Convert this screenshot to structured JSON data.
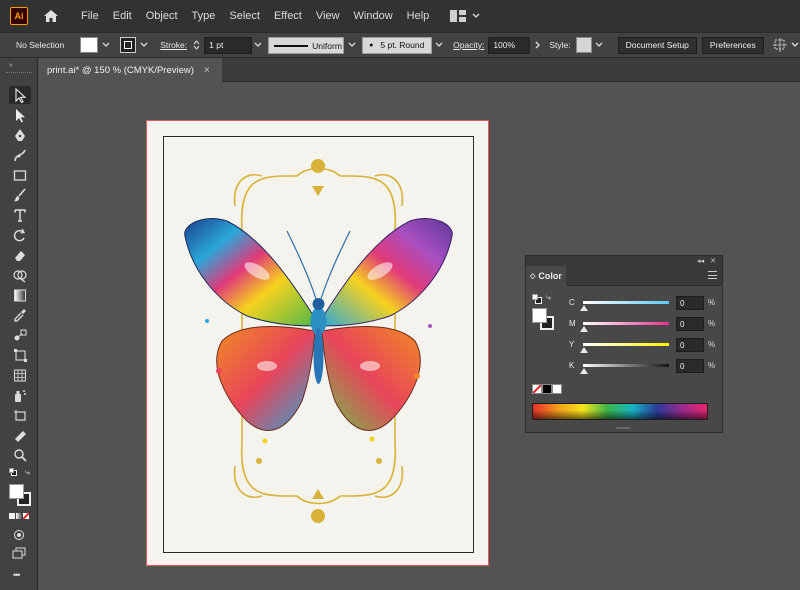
{
  "app": {
    "logo_text": "Ai",
    "accent": "#ff9a00"
  },
  "menu": [
    "File",
    "Edit",
    "Object",
    "Type",
    "Select",
    "Effect",
    "View",
    "Window",
    "Help"
  ],
  "control_bar": {
    "selection": "No Selection",
    "stroke_label": "Stroke:",
    "stroke_weight": "1 pt",
    "profile": "Uniform",
    "brush": "5 pt. Round",
    "opacity_label": "Opacity:",
    "opacity_value": "100%",
    "style_label": "Style:",
    "document_setup": "Document Setup",
    "preferences": "Preferences"
  },
  "document_tab": {
    "title": "print.ai* @ 150 % (CMYK/Preview)",
    "close": "×"
  },
  "color_panel": {
    "title": "Color",
    "channels": [
      {
        "letter": "C",
        "value": "0",
        "unit": "%",
        "gradient": "#5bc8f5"
      },
      {
        "letter": "M",
        "value": "0",
        "unit": "%",
        "gradient": "#ea2f8e"
      },
      {
        "letter": "Y",
        "value": "0",
        "unit": "%",
        "gradient": "#fff200"
      },
      {
        "letter": "K",
        "value": "0",
        "unit": "%",
        "gradient": "#111111"
      }
    ]
  },
  "toolbar": {
    "tools": [
      "selection-tool",
      "direct-selection-tool",
      "pen-tool",
      "curvature-tool",
      "rectangle-tool",
      "paintbrush-tool",
      "type-tool",
      "rotate-tool",
      "eraser-tool",
      "shape-builder-tool",
      "gradient-tool",
      "eyedropper-tool",
      "blend-tool",
      "free-transform-tool",
      "mesh-tool",
      "symbol-sprayer-tool",
      "artboard-tool",
      "measure-tool",
      "zoom-tool"
    ],
    "more": "•••"
  }
}
